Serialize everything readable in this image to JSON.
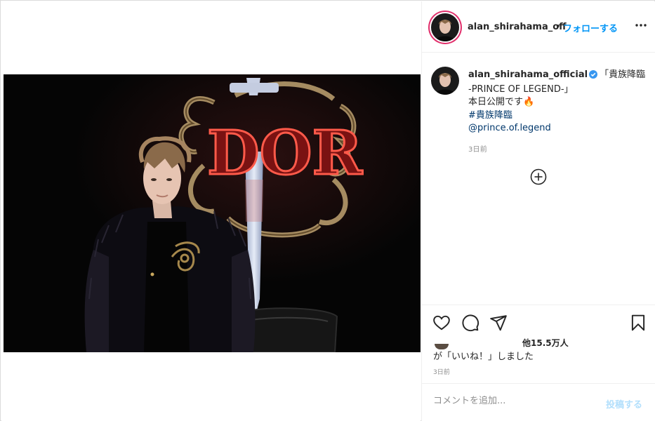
{
  "post": {
    "username": "alan_shirahama_off",
    "separator": "•",
    "follow_label": "フォローする",
    "more_icon": "more-horizontal-icon"
  },
  "caption": {
    "username": "alan_shirahama_official",
    "verified_icon": "verified-badge-icon",
    "line1": "「貴族降臨",
    "line2": "-PRINCE OF LEGEND-」",
    "line3": "本日公開です🔥",
    "hashtag": "#貴族降臨",
    "mention": "@prince.of.legend",
    "time": "3日前"
  },
  "actions": {
    "like_icon": "heart-icon",
    "comment_icon": "comment-icon",
    "share_icon": "paper-plane-icon",
    "save_icon": "bookmark-icon",
    "load_more_icon": "plus-circle-icon"
  },
  "likes": {
    "count_text": "他15.5万人",
    "suffix_text": "が「いいね！」しました",
    "time": "3日前"
  },
  "comment_box": {
    "placeholder": "コメントを追加...",
    "post_label": "投稿する"
  },
  "photo": {
    "sign_text": "DOR"
  },
  "colors": {
    "accent_blue": "#0095f6",
    "link_blue": "#00376b",
    "secondary_gray": "#8e8e8e",
    "border": "#dbdbdb",
    "disabled_blue": "#b2dffc"
  }
}
